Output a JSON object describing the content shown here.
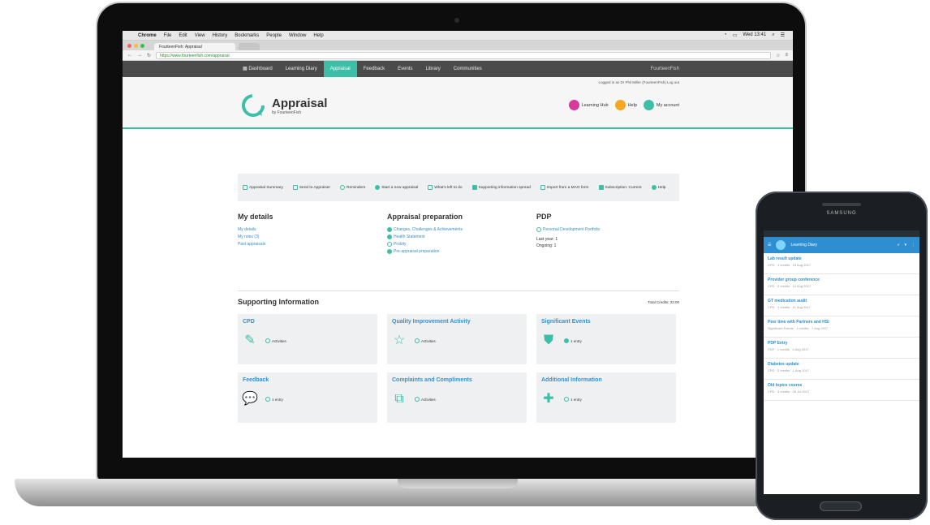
{
  "mac_menu": {
    "apple": "",
    "items": [
      "Chrome",
      "File",
      "Edit",
      "View",
      "History",
      "Bookmarks",
      "People",
      "Window",
      "Help"
    ],
    "right": "Wed 13:41"
  },
  "browser": {
    "tab_title": "FourteenFish: Appraisal",
    "tab_new": "",
    "address": "https://www.fourteenfish.com/appraisal"
  },
  "site_nav": {
    "items": [
      "Dashboard",
      "Learning Diary",
      "Appraisal",
      "Feedback",
      "Events",
      "Library",
      "Communities"
    ],
    "active_index": 2,
    "brand": "FourteenFish"
  },
  "header": {
    "logged_in": "Logged in as Dr Phil Miller (FourteenFish)   Log out",
    "title": "Appraisal",
    "subtitle": "by FourteenFish",
    "links": [
      {
        "label": "Learning Hub",
        "color": "#d9399a"
      },
      {
        "label": "Help",
        "color": "#f5a623"
      },
      {
        "label": "My account",
        "color": "#3cbfa6"
      }
    ]
  },
  "toolbar": {
    "items": [
      "Appraisal Summary",
      "Send to Appraiser",
      "Reminders",
      "Start a new appraisal",
      "What's left to do",
      "Supporting information spread",
      "Import from a MAG form",
      "Subscription: Current",
      "Help"
    ]
  },
  "my_details": {
    "title": "My details",
    "links": [
      "My details",
      "My roles (3)",
      "Past appraisals"
    ]
  },
  "appraisal_prep": {
    "title": "Appraisal preparation",
    "links": [
      "Changes, Challenges & Achievements",
      "Health Statement",
      "Probity",
      "Pre-appraisal preparation"
    ]
  },
  "pdp": {
    "title": "PDP",
    "link": "Personal Development Portfolio",
    "lines": [
      "Last year: 1",
      "Ongoing: 1"
    ]
  },
  "supporting": {
    "title": "Supporting Information",
    "credits": "Total Credits: 23.00",
    "cards": [
      {
        "title": "CPD",
        "icon": "pencil-icon",
        "glyph": "✎",
        "status": "Activities"
      },
      {
        "title": "Quality Improvement Activity",
        "icon": "star-icon",
        "glyph": "☆",
        "status": "Activities"
      },
      {
        "title": "Significant Events",
        "icon": "shield-icon",
        "glyph": "⛊",
        "status": "1 entry"
      },
      {
        "title": "Feedback",
        "icon": "speech-bubbles-icon",
        "glyph": "💬",
        "status": "1 entry"
      },
      {
        "title": "Complaints and Compliments",
        "icon": "documents-icon",
        "glyph": "⧉",
        "status": "Activities"
      },
      {
        "title": "Additional Information",
        "icon": "plus-icon",
        "glyph": "✚",
        "status": "1 entry"
      }
    ]
  },
  "phone": {
    "brand": "SAMSUNG",
    "app_title": "Learning Diary",
    "items": [
      {
        "title": "Lab result update",
        "sub": "CPD · 1 credits · 15 Aug 2017"
      },
      {
        "title": "Provider group conference",
        "sub": "CPD · 2 credits · 14 Aug 2017"
      },
      {
        "title": "GT medication audit",
        "sub": "CPD · 1 credits · 11 Aug 2017"
      },
      {
        "title": "Peer time with Partners and HSI",
        "sub": "Significant Events · 1 credits · 7 Aug 2017"
      },
      {
        "title": "PDP Entry",
        "sub": "PDP · 1 credits · 4 Aug 2017"
      },
      {
        "title": "Diabetes update",
        "sub": "CPD · 2 credits · 1 Aug 2017"
      },
      {
        "title": "Old topics course",
        "sub": "CPD · 3 credits · 28 Jul 2017"
      }
    ]
  }
}
